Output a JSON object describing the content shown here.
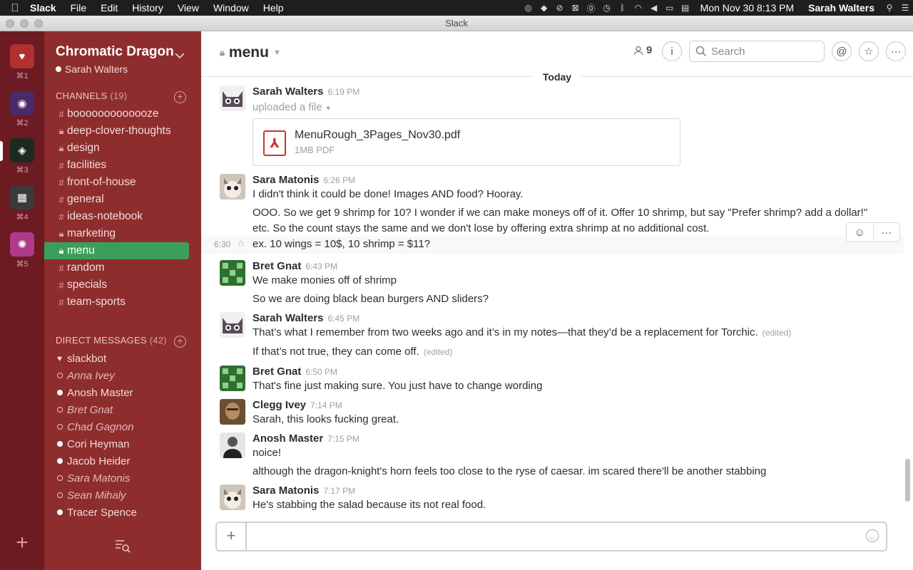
{
  "menubar": {
    "app": "Slack",
    "items": [
      "File",
      "Edit",
      "History",
      "View",
      "Window",
      "Help"
    ],
    "clock": "Mon Nov 30  8:13 PM",
    "user": "Sarah Walters"
  },
  "window": {
    "title": "Slack"
  },
  "teams": [
    {
      "shortcut": "⌘1",
      "color": "#b03030"
    },
    {
      "shortcut": "⌘2",
      "color": "#4a2a6a"
    },
    {
      "shortcut": "⌘3",
      "color": "#1d2b1f"
    },
    {
      "shortcut": "⌘4",
      "color": "#3a3a3a"
    },
    {
      "shortcut": "⌘5",
      "color": "#b03a8a"
    }
  ],
  "sidebar": {
    "team_name": "Chromatic Dragon",
    "user": "Sarah Walters",
    "channels_header": "CHANNELS",
    "channels_count": "(19)",
    "channels": [
      {
        "name": "booooooooooooze",
        "private": false
      },
      {
        "name": "deep-clover-thoughts",
        "private": true
      },
      {
        "name": "design",
        "private": true
      },
      {
        "name": "facilities",
        "private": false
      },
      {
        "name": "front-of-house",
        "private": false
      },
      {
        "name": "general",
        "private": false
      },
      {
        "name": "ideas-notebook",
        "private": false
      },
      {
        "name": "marketing",
        "private": true
      },
      {
        "name": "menu",
        "private": true,
        "active": true
      },
      {
        "name": "random",
        "private": false
      },
      {
        "name": "specials",
        "private": false
      },
      {
        "name": "team-sports",
        "private": false
      }
    ],
    "dm_header": "DIRECT MESSAGES",
    "dm_count": "(42)",
    "dms": [
      {
        "name": "slackbot",
        "status": "bot"
      },
      {
        "name": "Anna Ivey",
        "status": "away"
      },
      {
        "name": "Anosh Master",
        "status": "online"
      },
      {
        "name": "Bret Gnat",
        "status": "away"
      },
      {
        "name": "Chad Gagnon",
        "status": "away"
      },
      {
        "name": "Cori Heyman",
        "status": "online"
      },
      {
        "name": "Jacob Heider",
        "status": "online"
      },
      {
        "name": "Sara Matonis",
        "status": "away"
      },
      {
        "name": "Sean Mihaly",
        "status": "away"
      },
      {
        "name": "Tracer Spence",
        "status": "online"
      }
    ]
  },
  "header": {
    "channel": "menu",
    "member_count": "9",
    "search_placeholder": "Search"
  },
  "messages": {
    "day": "Today",
    "m1": {
      "author": "Sarah Walters",
      "time": "6:19 PM",
      "text": "uploaded a file",
      "file_name": "MenuRough_3Pages_Nov30.pdf",
      "file_meta": "1MB PDF"
    },
    "m2": {
      "author": "Sara Matonis",
      "time": "6:26 PM",
      "l1": "I didn't think it could be done! Images AND food? Hooray.",
      "l2": "OOO. So we get 9 shrimp for 10? I wonder if we can make moneys off of it. Offer 10 shrimp, but say \"Prefer shrimp? add a dollar!\" etc. So the count stays the same and we don't lose by offering extra shrimp at no additional cost.",
      "l3_time": "6:30",
      "l3": "ex. 10 wings = 10$, 10 shrimp = $11?"
    },
    "m3": {
      "author": "Bret Gnat",
      "time": "6:43 PM",
      "l1": "We make monies off of shrimp",
      "l2": "So we are doing black bean burgers AND sliders?"
    },
    "m4": {
      "author": "Sarah Walters",
      "time": "6:45 PM",
      "l1": "That’s what I remember from two weeks ago and it’s in my notes—that they’d be a replacement for Torchic.",
      "l2": "If that’s not true, they can come off.",
      "edited": "(edited)"
    },
    "m5": {
      "author": "Bret Gnat",
      "time": "6:50 PM",
      "l1": "That's fine just making sure. You just have to change wording"
    },
    "m6": {
      "author": "Clegg Ivey",
      "time": "7:14 PM",
      "l1": "Sarah, this looks fucking great."
    },
    "m7": {
      "author": "Anosh Master",
      "time": "7:15 PM",
      "l1": "noice!",
      "l2": "although the dragon-knight's horn feels too close to the ryse of caesar. im scared there'll be another stabbing"
    },
    "m8": {
      "author": "Sara Matonis",
      "time": "7:17 PM",
      "l1": "He's stabbing the salad because its not real food."
    }
  },
  "composer": {
    "placeholder": ""
  }
}
